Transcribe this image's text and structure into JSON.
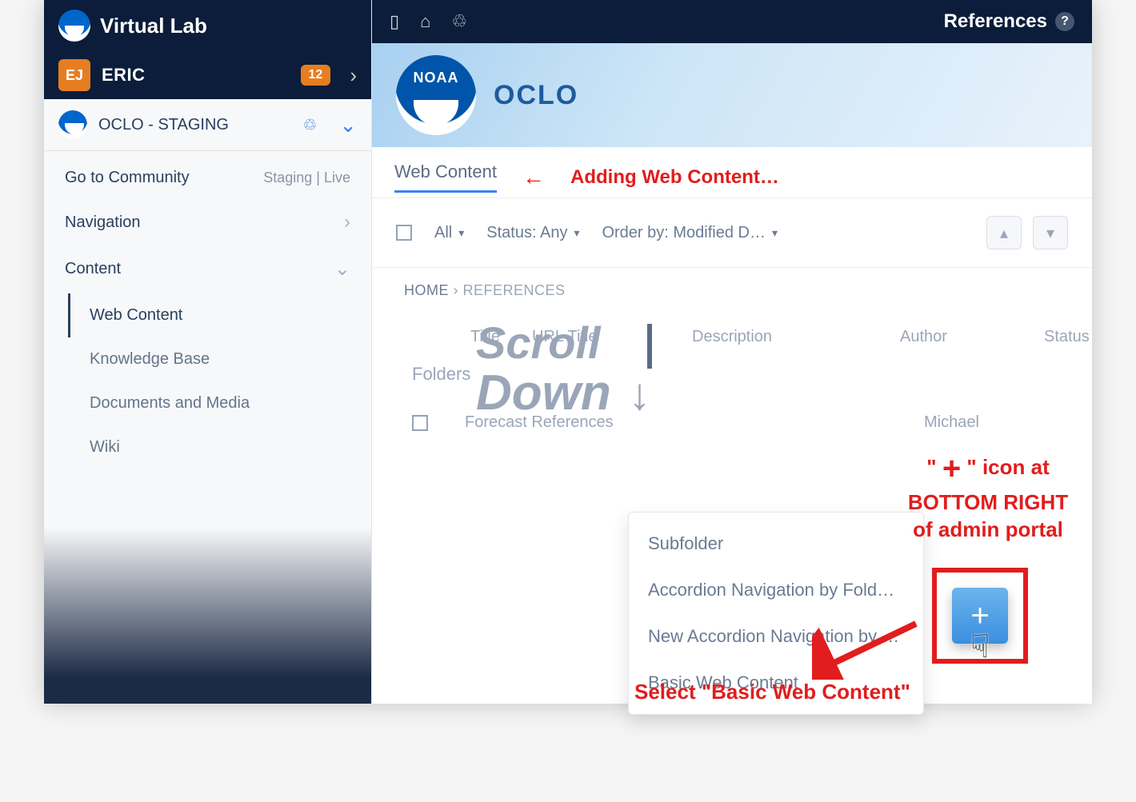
{
  "sidebar": {
    "app_title": "Virtual Lab",
    "user": {
      "initials": "EJ",
      "name": "ERIC",
      "notif_count": "12"
    },
    "site": {
      "name": "OCLO - STAGING"
    },
    "go_to_community": "Go to Community",
    "staging_live": "Staging | Live",
    "nav_label": "Navigation",
    "content_label": "Content",
    "subitems": {
      "web_content": "Web Content",
      "knowledge_base": "Knowledge Base",
      "documents_media": "Documents and Media",
      "wiki": "Wiki"
    }
  },
  "topbar": {
    "references": "References"
  },
  "hero": {
    "logo_text": "NOAA",
    "title": "OCLO"
  },
  "tabs": {
    "web_content": "Web Content"
  },
  "toolbar": {
    "all": "All",
    "status_label": "Status: Any",
    "order_label": "Order by: Modified D…"
  },
  "breadcrumb": {
    "home": "HOME",
    "sep": "›",
    "current": "REFERENCES"
  },
  "table": {
    "title": "Title",
    "url": "URL Title",
    "desc": "Description",
    "author": "Author",
    "status": "Status",
    "folders": "Folders"
  },
  "rows": {
    "r1_title": "Forecast References",
    "r1_author": "Michael"
  },
  "add_menu": {
    "subfolder": "Subfolder",
    "accordion": "Accordion Navigation by Folder I…",
    "new_accordion": "New Accordion Navigation by F…",
    "basic": "Basic Web Content"
  },
  "annot": {
    "adding": "Adding Web Content…",
    "scroll": "Scroll",
    "down": "Down",
    "plus_line1_a": "\"",
    "plus_symbol": "+",
    "plus_line1_b": "\" icon at",
    "plus_line2": "BOTTOM RIGHT",
    "plus_line3": "of admin portal",
    "select": "Select \"Basic Web Content\""
  }
}
